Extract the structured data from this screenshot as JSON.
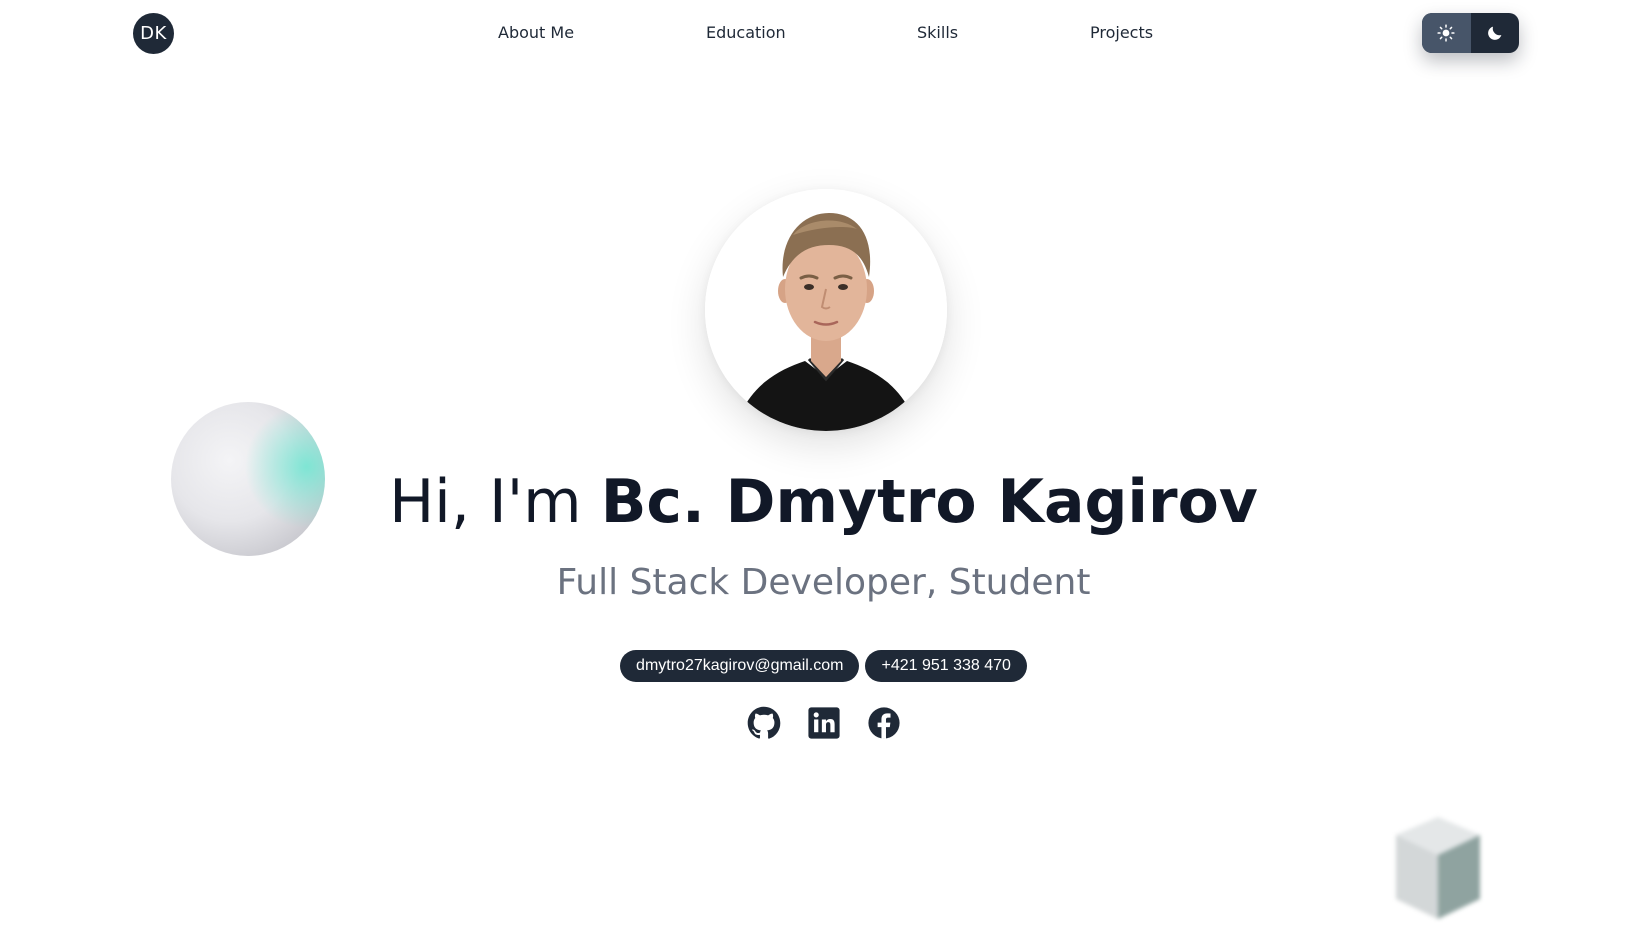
{
  "header": {
    "logo_text": "DK",
    "nav": {
      "about": "About Me",
      "education": "Education",
      "skills": "Skills",
      "projects": "Projects"
    },
    "theme_toggle": {
      "light_icon": "sun-icon",
      "dark_icon": "moon-icon",
      "active": "light"
    }
  },
  "hero": {
    "greeting": "Hi, I'm ",
    "name": "Bc. Dmytro Kagirov",
    "subtitle": "Full Stack Developer, Student",
    "email": "dmytro27kagirov@gmail.com",
    "phone": "+421 951 338 470",
    "socials": [
      "github-icon",
      "linkedin-icon",
      "facebook-icon"
    ]
  },
  "colors": {
    "primary_dark": "#1f2937",
    "toggle_active": "#475569",
    "subtitle": "#6b7280",
    "sphere_accent": "#6ee7d2"
  }
}
